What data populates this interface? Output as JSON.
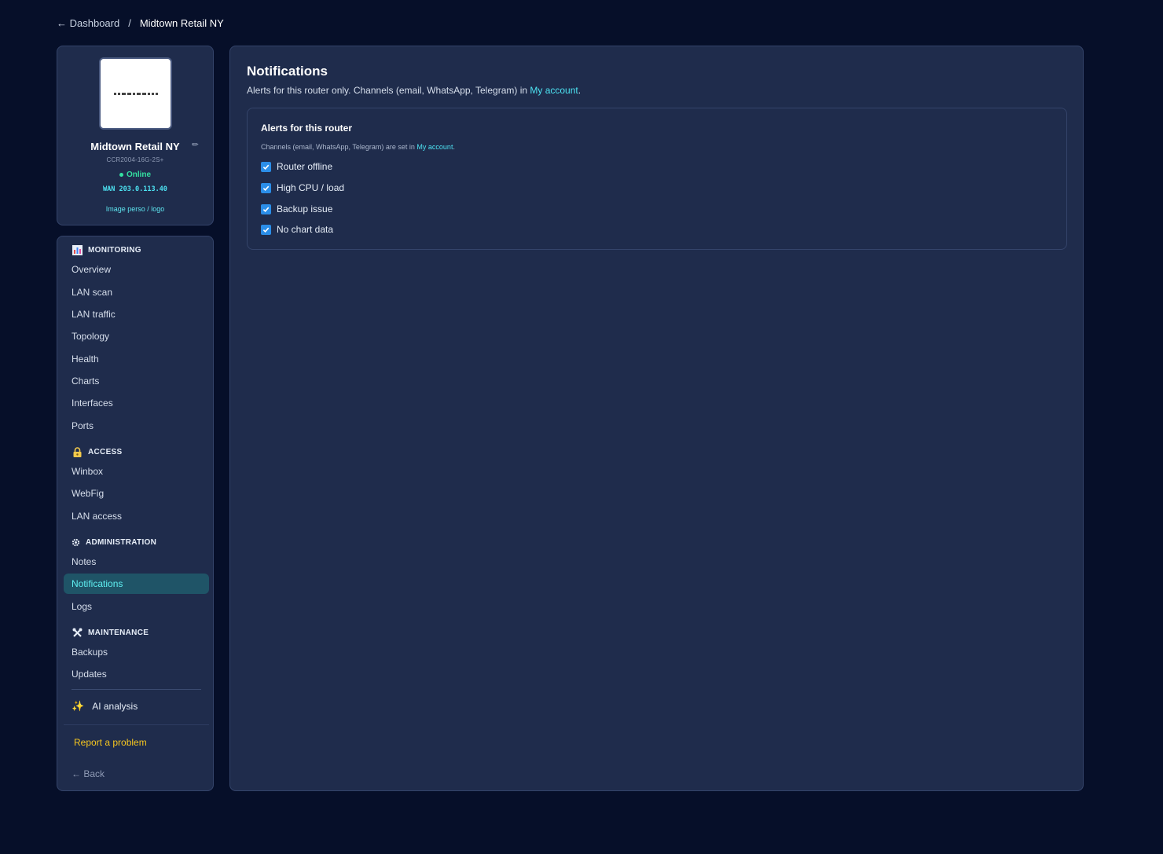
{
  "breadcrumb": {
    "back": "← Dashboard",
    "separator": "/",
    "current": "Midtown Retail NY"
  },
  "router": {
    "name": "Midtown Retail NY",
    "model": "CCR2004-16G-2S+",
    "status": "Online",
    "wan": "WAN 203.0.113.40",
    "image_link": "Image perso / logo",
    "status_color": "#34e0a1"
  },
  "sidebar": {
    "sections": [
      {
        "title": "MONITORING",
        "icon": "bar-chart-icon",
        "items": [
          "Overview",
          "LAN scan",
          "LAN traffic",
          "Topology",
          "Health",
          "Charts",
          "Interfaces",
          "Ports"
        ]
      },
      {
        "title": "ACCESS",
        "icon": "lock-icon",
        "items": [
          "Winbox",
          "WebFig",
          "LAN access"
        ]
      },
      {
        "title": "ADMINISTRATION",
        "icon": "gear-icon",
        "items": [
          "Notes",
          "Notifications",
          "Logs"
        ]
      },
      {
        "title": "MAINTENANCE",
        "icon": "tools-icon",
        "items": [
          "Backups",
          "Updates"
        ]
      }
    ],
    "active_item": "Notifications",
    "ai": {
      "label": "AI analysis",
      "icon": "sparkles-icon"
    },
    "report": "Report a problem",
    "back": "← Back"
  },
  "main": {
    "title": "Notifications",
    "subtitle_prefix": "Alerts for this router only. Channels (email, WhatsApp, Telegram) in ",
    "subtitle_link": "My account",
    "subtitle_suffix": ".",
    "alerts_card": {
      "title": "Alerts for this router",
      "sub_prefix": "Channels (email, WhatsApp, Telegram) are set in ",
      "sub_link": "My account",
      "sub_suffix": ".",
      "options": [
        {
          "label": "Router offline",
          "checked": true
        },
        {
          "label": "High CPU / load",
          "checked": true
        },
        {
          "label": "Backup issue",
          "checked": true
        },
        {
          "label": "No chart data",
          "checked": true
        }
      ]
    }
  },
  "colors": {
    "background": "#060f29",
    "card": "#1f2c4c",
    "accent": "#4de3f2",
    "active_bg": "#1f5467",
    "warning": "#f6c61f",
    "checkbox": "#2b8ee8"
  }
}
